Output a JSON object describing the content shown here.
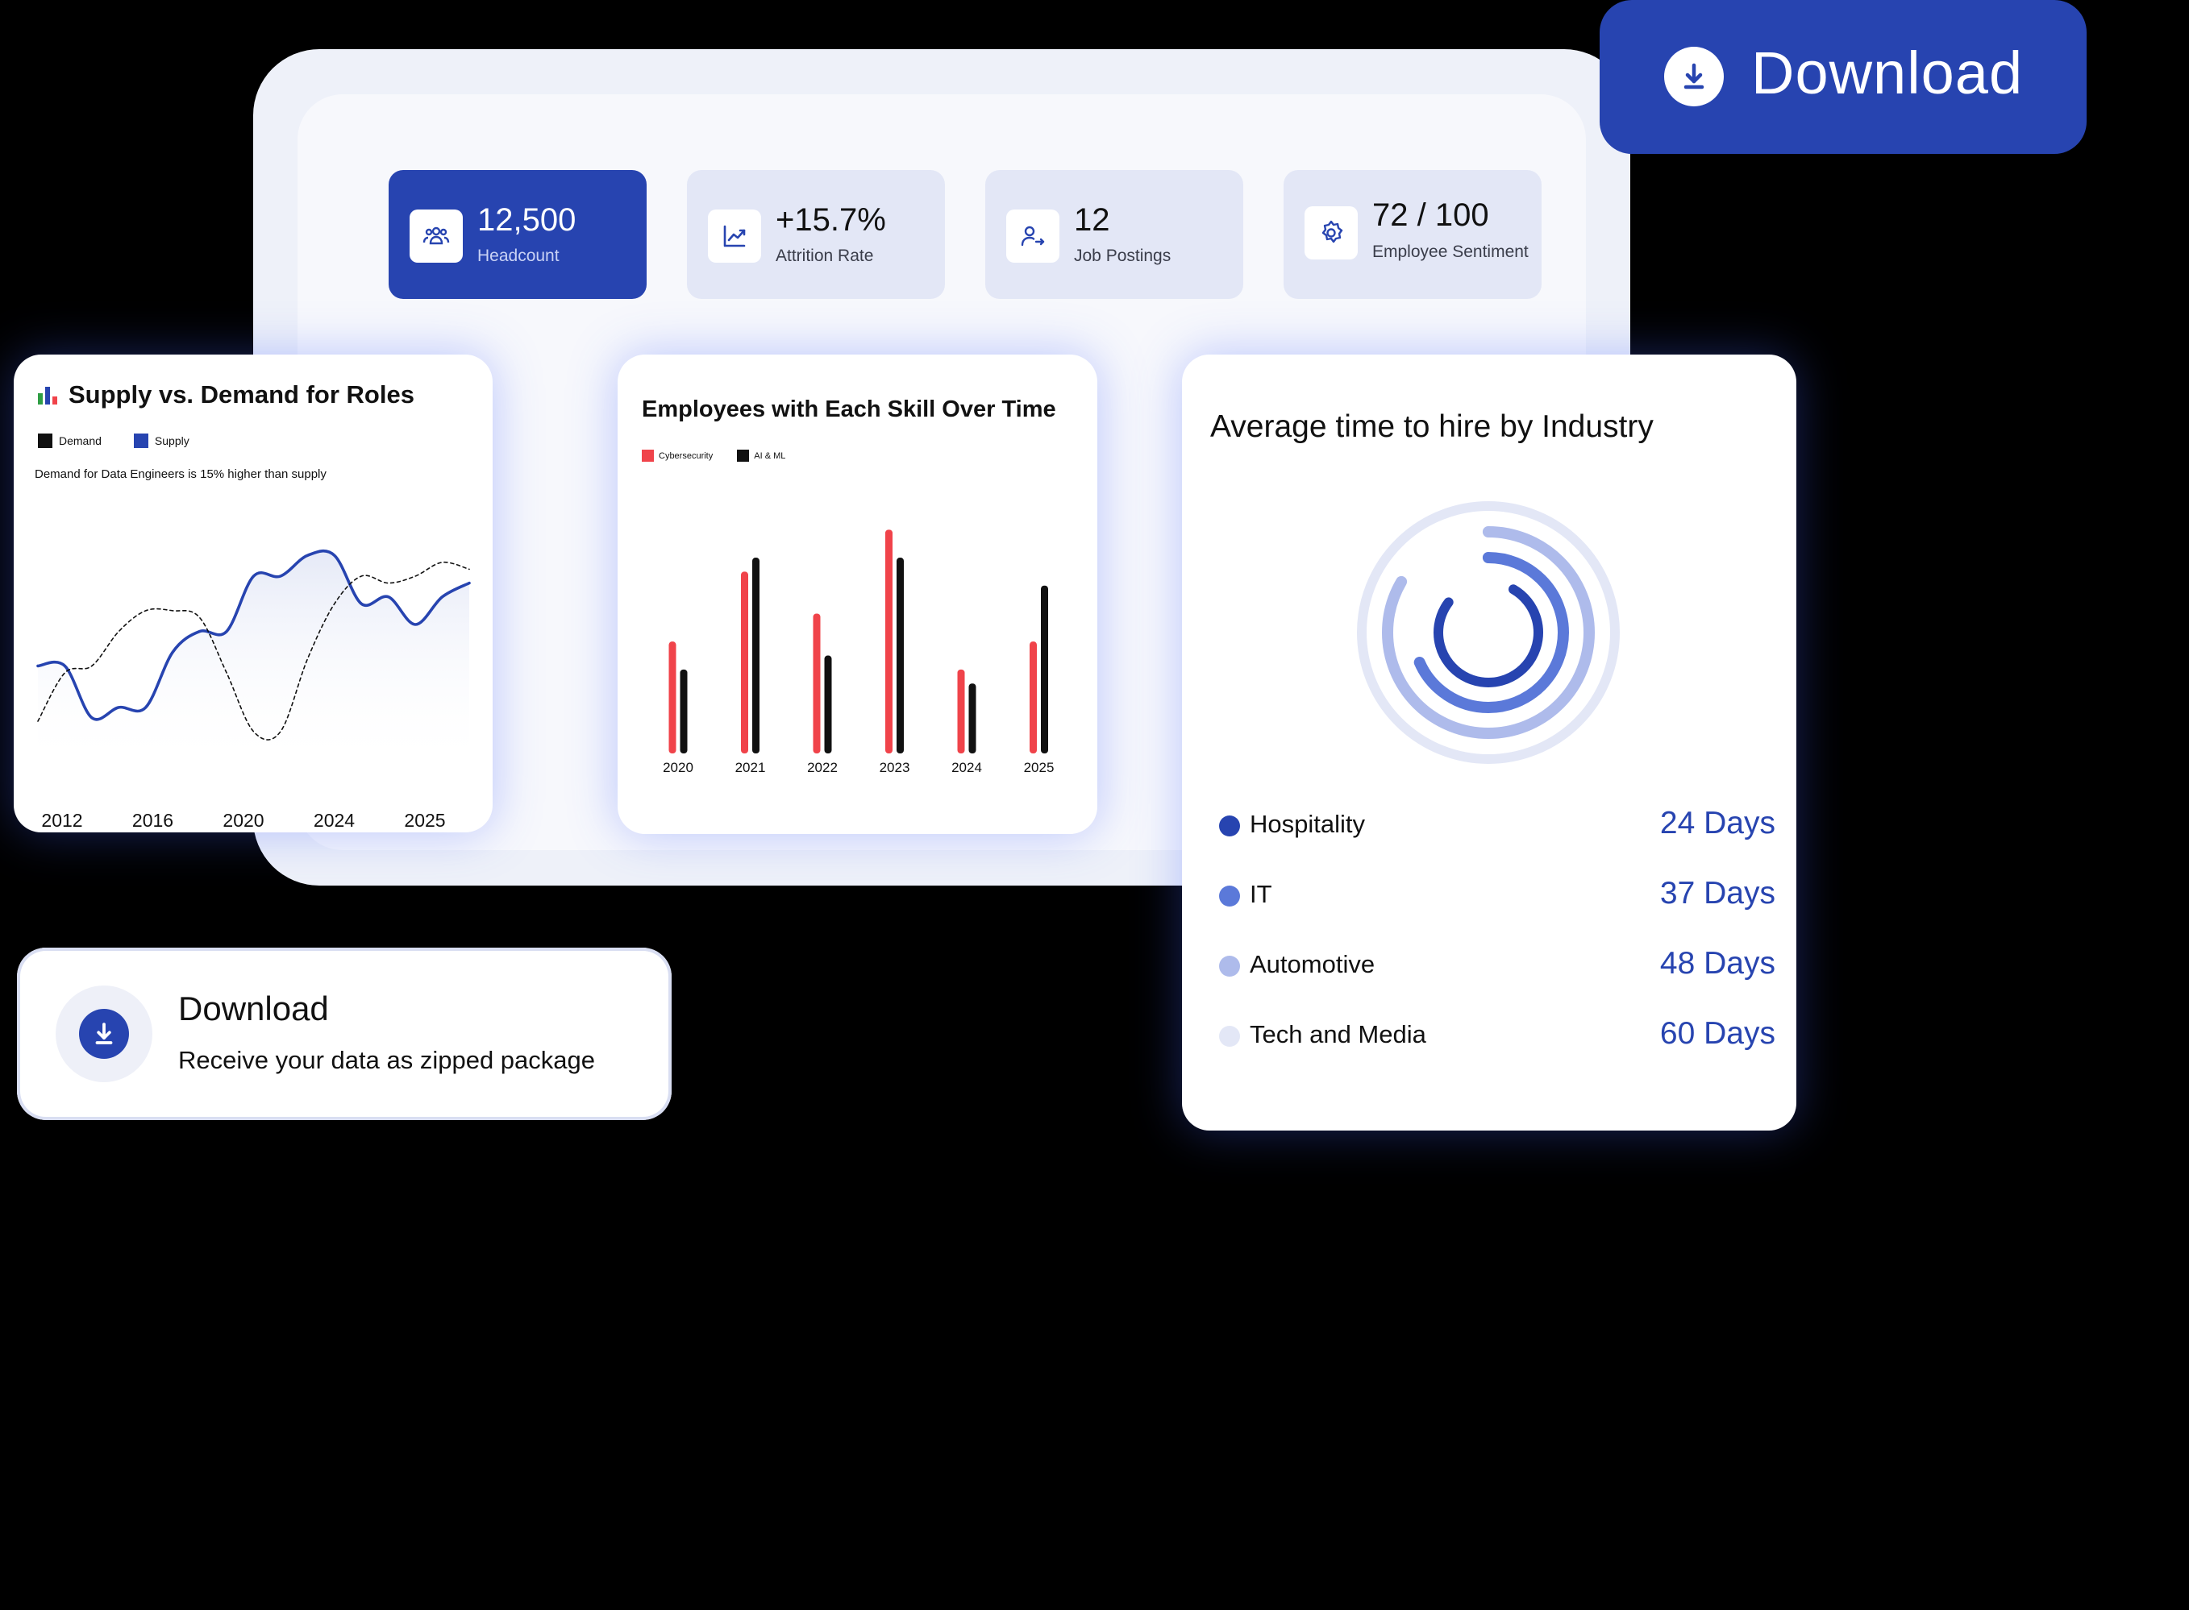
{
  "download_button": {
    "label": "Download",
    "icon": "download-icon"
  },
  "stats": [
    {
      "value": "12,500",
      "label": "Headcount",
      "icon": "people-icon",
      "active": true
    },
    {
      "value": "+15.7%",
      "label": "Attrition Rate",
      "icon": "trend-up-icon",
      "active": false
    },
    {
      "value": "12",
      "label": "Job Postings",
      "icon": "user-arrow-icon",
      "active": false
    },
    {
      "value": "72 / 100",
      "label": "Employee Sentiment",
      "icon": "gear-icon",
      "active": false
    }
  ],
  "supply_demand": {
    "title": "Supply vs. Demand for Roles",
    "icon": "bar-chart-emoji-icon",
    "note": "Demand for Data Engineers is 15% higher than supply",
    "chart_data": {
      "type": "line",
      "x_ticks": [
        "2012",
        "2016",
        "2020",
        "2024",
        "2025"
      ],
      "series": [
        {
          "name": "Demand",
          "color": "#111111",
          "style": "dashed",
          "values": [
            44,
            58,
            60,
            70,
            76,
            76,
            74,
            58,
            41,
            41,
            62,
            78,
            86,
            84,
            86,
            90,
            88
          ]
        },
        {
          "name": "Supply",
          "color": "#2744b0",
          "style": "solid",
          "values": [
            60,
            60,
            45,
            48,
            48,
            64,
            70,
            70,
            86,
            86,
            92,
            92,
            78,
            80,
            72,
            80,
            84
          ]
        }
      ]
    }
  },
  "skills_chart": {
    "title": "Employees with Each Skill Over Time",
    "chart_data": {
      "type": "bar",
      "categories": [
        "2020",
        "2021",
        "2022",
        "2023",
        "2024",
        "2025"
      ],
      "series": [
        {
          "name": "Cybersecurity",
          "color": "#f0434a",
          "values": [
            40,
            65,
            50,
            80,
            30,
            40
          ]
        },
        {
          "name": "AI & ML",
          "color": "#111111",
          "values": [
            30,
            70,
            35,
            70,
            25,
            60
          ]
        }
      ],
      "ylim": [
        0,
        85
      ]
    }
  },
  "time_to_hire": {
    "title": "Average time to hire by Industry",
    "industries": [
      {
        "name": "Hospitality",
        "days": "24 Days",
        "color": "#2744b0"
      },
      {
        "name": "IT",
        "days": "37 Days",
        "color": "#5b79d9"
      },
      {
        "name": "Automotive",
        "days": "48 Days",
        "color": "#aebbeb"
      },
      {
        "name": "Tech and Media",
        "days": "60 Days",
        "color": "#e3e7f6"
      }
    ]
  },
  "download_card": {
    "title": "Download",
    "subtitle": "Receive your data as zipped package",
    "icon": "download-icon"
  }
}
